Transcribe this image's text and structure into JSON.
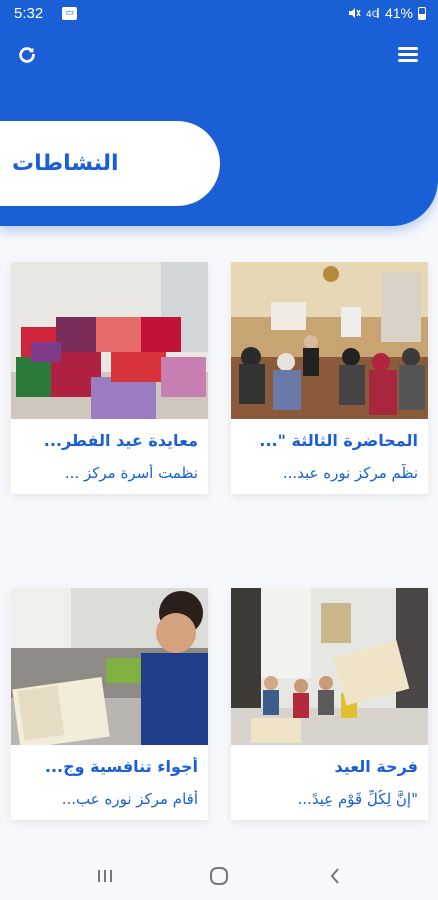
{
  "status_bar": {
    "time": "5:32",
    "notification_icon": "tv-icon",
    "battery_percent": "41%",
    "icons": [
      "mute-icon",
      "signal-icon",
      "battery-icon"
    ]
  },
  "header": {
    "title": "النشاطات",
    "refresh_icon": "refresh-icon",
    "menu_icon": "hamburger-menu-icon",
    "color": "#1a5fd6"
  },
  "cards": [
    {
      "title": "المحاضرة الثالثة \"...",
      "description": "نظّم مركز نوره عبد...",
      "image": "lecture-hall-photo"
    },
    {
      "title": "معايدة عيد الفطر...",
      "description": "نظمت أسرة مركز ...",
      "image": "eid-gifts-bags-photo"
    },
    {
      "title": "فرحة العيد",
      "description": "\"إنَّ لِكُلِّ قَوْمٍ عِيدً...",
      "image": "children-reading-quran-photo"
    },
    {
      "title": "أجواء تنافسية وج...",
      "description": "أقام مركز نوره عب...",
      "image": "boy-reading-quran-photo"
    }
  ],
  "nav_bar": {
    "recents_icon": "recents-icon",
    "home_icon": "home-icon",
    "back_icon": "back-icon"
  }
}
